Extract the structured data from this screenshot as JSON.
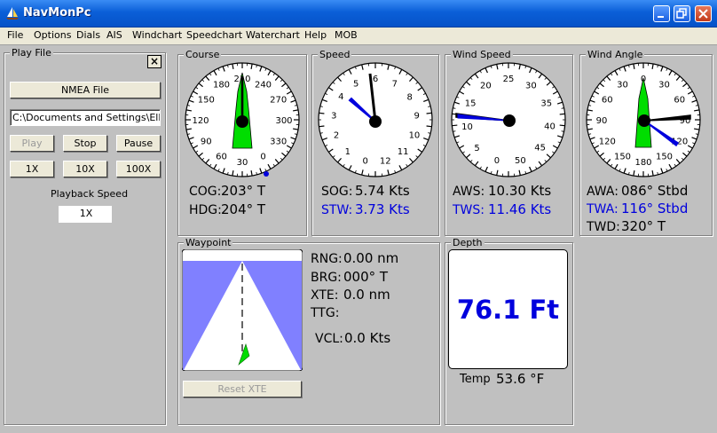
{
  "window": {
    "title": "NavMonPc"
  },
  "menu": [
    "File",
    "Options",
    "Dials",
    "AIS",
    "Windchart",
    "Speedchart",
    "Waterchart",
    "Help",
    "MOB"
  ],
  "play_file": {
    "title": "Play File",
    "close_label": "×",
    "nmea_button": "NMEA File",
    "path": "C:\\Documents and Settings\\Elliott",
    "play": "Play",
    "stop": "Stop",
    "pause": "Pause",
    "speed_1x": "1X",
    "speed_10x": "10X",
    "speed_100x": "100X",
    "speed_label": "Playback Speed",
    "speed_value": "1X"
  },
  "course": {
    "title": "Course",
    "ticks": [
      "210",
      "240",
      "270",
      "300",
      "330",
      "0",
      "30",
      "60",
      "90",
      "120",
      "150",
      "180"
    ],
    "cog_label": "COG:",
    "cog_value": "203° T",
    "hdg_label": "HDG:",
    "hdg_value": "204° T"
  },
  "speed": {
    "title": "Speed",
    "ticks": [
      "6",
      "7",
      "8",
      "9",
      "10",
      "11",
      "12",
      "0",
      "1",
      "2",
      "3",
      "4",
      "5"
    ],
    "sog_label": "SOG:",
    "sog_value": "5.74 Kts",
    "stw_label": "STW:",
    "stw_value": "3.73 Kts"
  },
  "wind_speed": {
    "title": "Wind Speed",
    "ticks": [
      "25",
      "30",
      "35",
      "40",
      "45",
      "50",
      "0",
      "5",
      "10",
      "15",
      "20"
    ],
    "aws_label": "AWS:",
    "aws_value": "10.30 Kts",
    "tws_label": "TWS:",
    "tws_value": "11.46 Kts"
  },
  "wind_angle": {
    "title": "Wind Angle",
    "ticks": [
      "0",
      "30",
      "60",
      "90",
      "120",
      "150",
      "180",
      "150",
      "120",
      "90",
      "60",
      "30"
    ],
    "awa_label": "AWA:",
    "awa_value": "086° Stbd",
    "twa_label": "TWA:",
    "twa_value": "116° Stbd",
    "twd_label": "TWD:",
    "twd_value": "320° T"
  },
  "waypoint": {
    "title": "Waypoint",
    "rng_label": "RNG:",
    "rng_value": "0.00 nm",
    "brg_label": "BRG:",
    "brg_value": "000° T",
    "xte_label": "XTE:",
    "xte_value": "0.0 nm",
    "ttg_label": "TTG:",
    "ttg_value": "",
    "vcl_label": "VCL:",
    "vcl_value": "0.0 Kts",
    "reset_button": "Reset XTE"
  },
  "depth": {
    "title": "Depth",
    "value": "76.1 Ft",
    "temp_label": "Temp",
    "temp_value": "53.6 °F"
  },
  "colors": {
    "accent_blue": "#0000dd",
    "needle_green": "#00dd00",
    "highway_sky": "#8080ff"
  }
}
